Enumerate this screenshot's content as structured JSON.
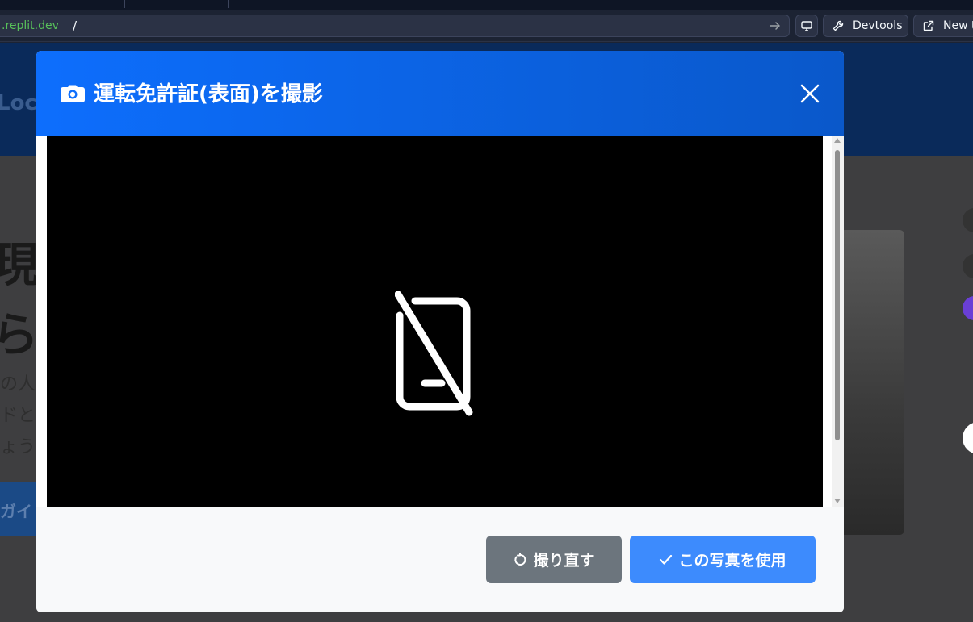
{
  "browser": {
    "url_domain": ".replit.dev",
    "url_path": "/",
    "devtools_label": "Devtools",
    "newtab_label": "New ta"
  },
  "background": {
    "logo_text": "Loca",
    "headline_1": "現地",
    "headline_2": "ら、",
    "text_1": "の人",
    "text_2": "ドと",
    "text_3": "ょう",
    "cta_text": "ガイド"
  },
  "modal": {
    "title": "運転免許証(表面)を撮影",
    "retake_label": "撮り直す",
    "use_photo_label": "この写真を使用"
  },
  "colors": {
    "header_start": "#0d6efd",
    "header_end": "#0a58ca",
    "retake_button": "#6c757d",
    "use_button": "#3d8bfd",
    "domain_text": "#58c15a"
  },
  "icons": {
    "title_icon": "camera-icon",
    "close_icon": "close-icon",
    "camera_placeholder": "mobile-off-icon",
    "retake_icon": "rotate-icon",
    "use_icon": "check-icon"
  }
}
